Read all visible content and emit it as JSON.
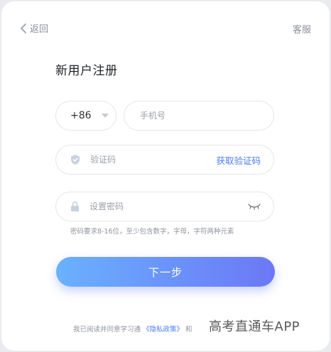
{
  "header": {
    "back_label": "返回",
    "service_label": "客服"
  },
  "page_title": "新用户注册",
  "form": {
    "country_code": "+86",
    "phone_placeholder": "手机号",
    "code_placeholder": "验证码",
    "get_code_label": "获取验证码",
    "password_placeholder": "设置密码",
    "password_hint": "密码要求8-16位，至少包含数字，字母，字符两种元素",
    "next_label": "下一步"
  },
  "agreement": {
    "prefix": "我已阅读并同意学习通",
    "privacy_link": "《隐私政策》",
    "connector": "和"
  },
  "watermark": "高考直通车APP",
  "colors": {
    "accent": "#4a7cf6",
    "button_start": "#6ab1ff",
    "button_end": "#6b78f5"
  }
}
